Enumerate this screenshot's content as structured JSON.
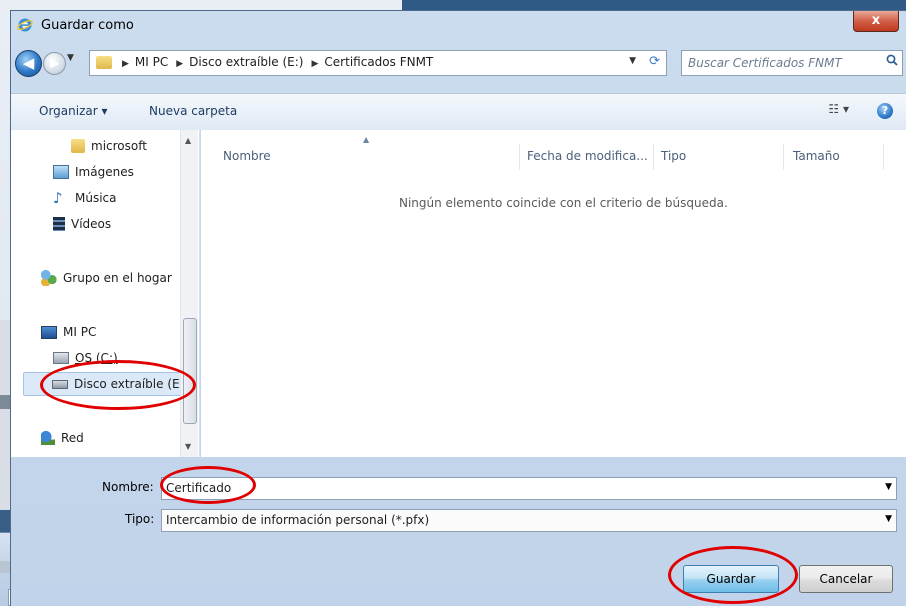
{
  "window": {
    "title": "Guardar como",
    "close_label": "x",
    "close_bg_label": "x"
  },
  "address": {
    "crumbs": [
      "MI PC",
      "Disco extraíble (E:)",
      "Certificados FNMT"
    ],
    "search_placeholder": "Buscar Certificados FNMT"
  },
  "toolbar": {
    "organize_label": "Organizar ▾",
    "new_folder_label": "Nueva carpeta",
    "view_label": "☷ ▾",
    "help_label": "?"
  },
  "nav": {
    "items": [
      {
        "label": "microsoft"
      },
      {
        "label": "Imágenes"
      },
      {
        "label": "Música"
      },
      {
        "label": "Vídeos"
      },
      {
        "label": "Grupo en el hogar"
      },
      {
        "label": "MI PC"
      },
      {
        "label": "OS (C:)"
      },
      {
        "label": "Disco extraíble (E"
      },
      {
        "label": "Red"
      }
    ]
  },
  "columns": {
    "name": "Nombre",
    "date": "Fecha de modifica...",
    "type": "Tipo",
    "size": "Tamaño"
  },
  "content": {
    "empty_message": "Ningún elemento coincide con el criterio de búsqueda."
  },
  "form": {
    "filename_label": "Nombre:",
    "filename_value": "Certificado",
    "type_label": "Tipo:",
    "type_value": "Intercambio de información personal (*.pfx)"
  },
  "buttons": {
    "save": "Guardar",
    "cancel": "Cancelar"
  },
  "colors": {
    "annotation": "#e00000",
    "accent": "#3c7fb1"
  }
}
